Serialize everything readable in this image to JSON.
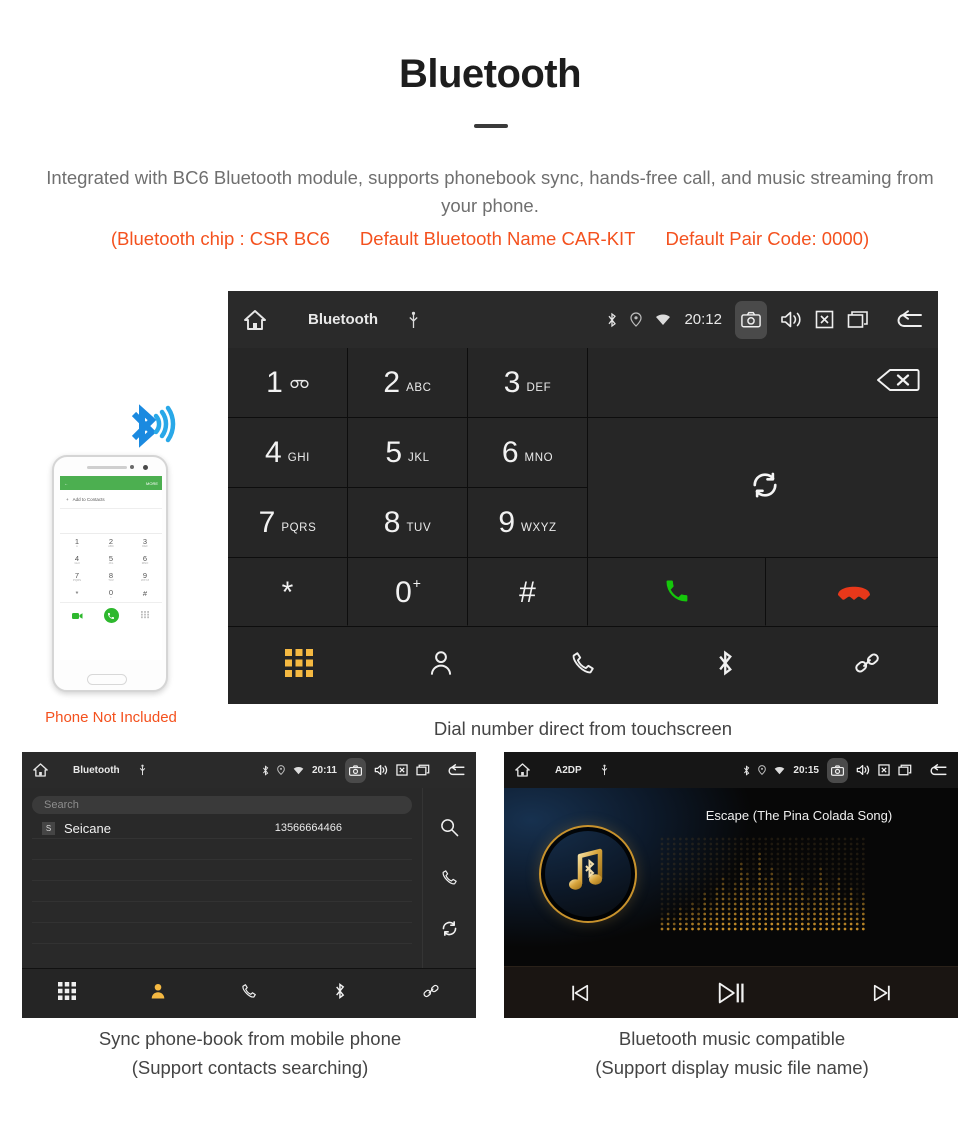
{
  "header": {
    "title": "Bluetooth",
    "description": "Integrated with BC6 Bluetooth module, supports phonebook sync, hands-free call, and music streaming from your phone.",
    "spec_chip": "(Bluetooth chip : CSR BC6",
    "spec_name": "Default Bluetooth Name CAR-KIT",
    "spec_pair": "Default Pair Code: 0000)",
    "accent_color": "#f4511e",
    "text_color": "#6f6f6f"
  },
  "dial_unit": {
    "statusbar": {
      "home_icon": "home-icon",
      "title": "Bluetooth",
      "usb_icon": "usb-icon",
      "bluetooth_icon": "bluetooth-icon",
      "location_icon": "location-icon",
      "wifi_icon": "wifi-icon",
      "clock": "20:12",
      "camera_icon": "camera-icon",
      "volume_icon": "volume-icon",
      "close_icon": "close-box-icon",
      "recents_icon": "recents-icon",
      "back_icon": "back-icon"
    },
    "keys": [
      {
        "digit": "1",
        "sub": "∞",
        "letters": ""
      },
      {
        "digit": "2",
        "sub": "",
        "letters": "ABC"
      },
      {
        "digit": "3",
        "sub": "",
        "letters": "DEF"
      },
      {
        "digit": "4",
        "sub": "",
        "letters": "GHI"
      },
      {
        "digit": "5",
        "sub": "",
        "letters": "JKL"
      },
      {
        "digit": "6",
        "sub": "",
        "letters": "MNO"
      },
      {
        "digit": "7",
        "sub": "",
        "letters": "PQRS"
      },
      {
        "digit": "8",
        "sub": "",
        "letters": "TUV"
      },
      {
        "digit": "9",
        "sub": "",
        "letters": "WXYZ"
      },
      {
        "digit": "*",
        "sub": "",
        "letters": ""
      },
      {
        "digit": "0",
        "sub": "+",
        "letters": ""
      },
      {
        "digit": "#",
        "sub": "",
        "letters": ""
      }
    ],
    "actions": {
      "backspace_icon": "backspace-icon",
      "sync_icon": "sync-icon",
      "call_icon": "call-icon",
      "hangup_icon": "hangup-icon",
      "call_color": "#15c60b",
      "hangup_color": "#e8381a"
    },
    "navbar": [
      {
        "icon": "dialpad-icon",
        "active": true
      },
      {
        "icon": "contacts-icon",
        "active": false
      },
      {
        "icon": "call-log-icon",
        "active": false
      },
      {
        "icon": "bluetooth-icon",
        "active": false
      },
      {
        "icon": "link-icon",
        "active": false
      }
    ],
    "active_color": "#f5b942"
  },
  "phone_mockup": {
    "top_back": "←",
    "top_more": "MORE",
    "add_contacts": "Add to Contacts",
    "keys": [
      {
        "d": "1",
        "s": "∞"
      },
      {
        "d": "2",
        "s": "ABC"
      },
      {
        "d": "3",
        "s": "DEF"
      },
      {
        "d": "4",
        "s": "GHI"
      },
      {
        "d": "5",
        "s": "JKL"
      },
      {
        "d": "6",
        "s": "MNO"
      },
      {
        "d": "7",
        "s": "PQRS"
      },
      {
        "d": "8",
        "s": "TUV"
      },
      {
        "d": "9",
        "s": "WXYZ"
      },
      {
        "d": "*",
        "s": ""
      },
      {
        "d": "0",
        "s": "+"
      },
      {
        "d": "#",
        "s": ""
      }
    ],
    "caption": "Phone Not Included",
    "caption_color": "#f4511e"
  },
  "captions": {
    "dial": "Dial number direct from touchscreen",
    "book_line1": "Sync phone-book from mobile phone",
    "book_line2": "(Support contacts searching)",
    "music_line1": "Bluetooth music compatible",
    "music_line2": "(Support display music file name)"
  },
  "book_unit": {
    "statusbar": {
      "home_icon": "home-icon",
      "title": "Bluetooth",
      "usb_icon": "usb-icon",
      "clock": "20:11",
      "camera_icon": "camera-icon",
      "volume_icon": "volume-icon",
      "close_icon": "close-box-icon",
      "recents_icon": "recents-icon",
      "back_icon": "back-icon"
    },
    "search_placeholder": "Search",
    "contact": {
      "initial": "S",
      "name": "Seicane",
      "number": "13566664466"
    },
    "side_icons": [
      "search-icon",
      "call-icon",
      "sync-icon"
    ],
    "navbar": [
      {
        "icon": "dialpad-icon",
        "active": false
      },
      {
        "icon": "contacts-icon",
        "active": true
      },
      {
        "icon": "call-log-icon",
        "active": false
      },
      {
        "icon": "bluetooth-icon",
        "active": false
      },
      {
        "icon": "link-icon",
        "active": false
      }
    ]
  },
  "music_unit": {
    "statusbar": {
      "home_icon": "home-icon",
      "title": "A2DP",
      "usb_icon": "usb-icon",
      "clock": "20:15",
      "camera_icon": "camera-icon",
      "volume_icon": "volume-icon",
      "close_icon": "close-box-icon",
      "recents_icon": "recents-icon",
      "back_icon": "back-icon"
    },
    "song_title": "Escape (The Pina Colada Song)",
    "album_art_icon": "music-note-bluetooth-icon",
    "equalizer_icon": "equalizer-dots",
    "controls": [
      {
        "icon": "previous-track-icon"
      },
      {
        "icon": "play-pause-icon"
      },
      {
        "icon": "next-track-icon"
      }
    ],
    "gold_color": "#d99b2b"
  }
}
